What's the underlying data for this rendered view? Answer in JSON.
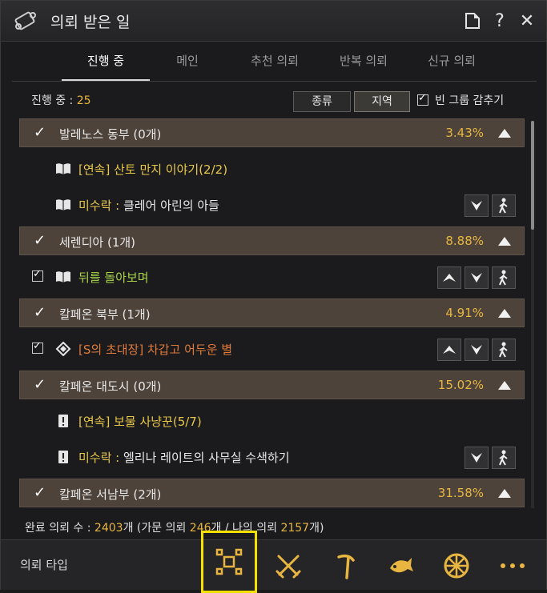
{
  "window": {
    "title": "의뢰 받은 일"
  },
  "tabs": [
    {
      "label": "진행 중",
      "active": true
    },
    {
      "label": "메인",
      "active": false
    },
    {
      "label": "추천 의뢰",
      "active": false
    },
    {
      "label": "반복 의뢰",
      "active": false
    },
    {
      "label": "신규 의뢰",
      "active": false
    }
  ],
  "progress": {
    "label": "진행 중 : ",
    "count": "25"
  },
  "filters": {
    "kind_label": "종류",
    "region_label": "지역",
    "hide_empty_label": "빈 그룹 감추기",
    "hide_empty_checked": true
  },
  "groups": [
    {
      "name": "발레노스 동부 (0개)",
      "percent": "3.43%"
    },
    {
      "name": "세렌디아 (1개)",
      "percent": "8.88%"
    },
    {
      "name": "칼페온 북부 (1개)",
      "percent": "4.91%"
    },
    {
      "name": "칼페온 대도시 (0개)",
      "percent": "15.02%"
    },
    {
      "name": "칼페온 서남부 (2개)",
      "percent": "31.58%"
    }
  ],
  "quests": [
    {
      "text": "[연속] 산토 만지 이야기(2/2)"
    },
    {
      "tag": "미수락 : ",
      "text": "클레어 아린의 아들"
    },
    {
      "text": "뒤를 돌아보며"
    },
    {
      "text": "[S의 초대장] 차갑고 어두운 별"
    },
    {
      "text": "[연속] 보물 사냥꾼(5/7)"
    },
    {
      "tag": "미수락 : ",
      "text": "엘리나 레이트의 사무실 수색하기"
    }
  ],
  "footer": {
    "label": "완료 의뢰 수 : ",
    "total": "2403",
    "unit": "개 (가문 의뢰 ",
    "family": "246",
    "mid": "개 / 나의 의뢰 ",
    "mine": "2157",
    "end": "개)"
  },
  "bottom": {
    "type_label": "의뢰 타입"
  },
  "colors": {
    "accent": "#e8b640",
    "selected_outline": "#f5e000",
    "group_bg": "#4d433b"
  }
}
